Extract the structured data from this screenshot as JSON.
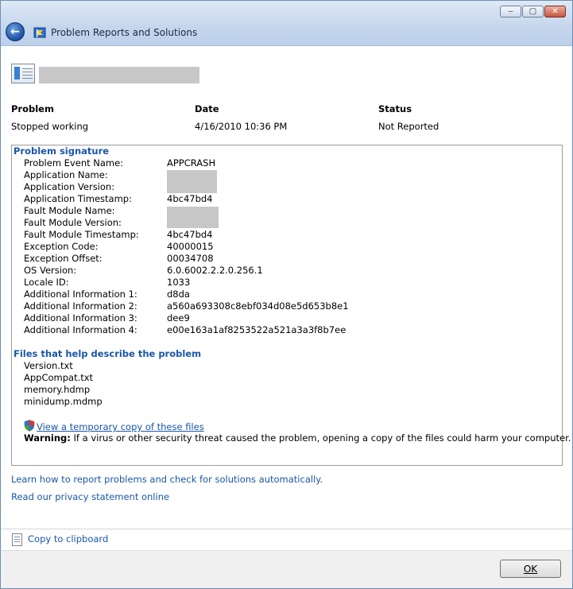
{
  "window": {
    "title": "Problem Reports and Solutions",
    "controls": {
      "minimize": "‒",
      "maximize": "▢",
      "close": "✕"
    }
  },
  "columns": {
    "problem_label": "Problem",
    "date_label": "Date",
    "status_label": "Status",
    "problem_value": "Stopped working",
    "date_value": "4/16/2010 10:36 PM",
    "status_value": "Not Reported"
  },
  "signature": {
    "heading": "Problem signature",
    "rows": [
      {
        "label": "Problem Event Name:",
        "value": "APPCRASH"
      },
      {
        "label": "Application Name:",
        "value": ""
      },
      {
        "label": "Application Version:",
        "value": ""
      },
      {
        "label": "Application Timestamp:",
        "value": "4bc47bd4"
      },
      {
        "label": "Fault Module Name:",
        "value": ""
      },
      {
        "label": "Fault Module Version:",
        "value": ""
      },
      {
        "label": "Fault Module Timestamp:",
        "value": "4bc47bd4"
      },
      {
        "label": "Exception Code:",
        "value": "40000015"
      },
      {
        "label": "Exception Offset:",
        "value": "00034708"
      },
      {
        "label": "OS Version:",
        "value": "6.0.6002.2.2.0.256.1"
      },
      {
        "label": "Locale ID:",
        "value": "1033"
      },
      {
        "label": "Additional Information 1:",
        "value": "d8da"
      },
      {
        "label": "Additional Information 2:",
        "value": "a560a693308c8ebf034d08e5d653b8e1"
      },
      {
        "label": "Additional Information 3:",
        "value": "dee9"
      },
      {
        "label": "Additional Information 4:",
        "value": "e00e163a1af8253522a521a3a3f8b7ee"
      }
    ]
  },
  "files": {
    "heading": "Files that help describe the problem",
    "items": [
      "Version.txt",
      "AppCompat.txt",
      "memory.hdmp",
      "minidump.mdmp"
    ],
    "view_link": "View a temporary copy of these files",
    "warning_label": "Warning:",
    "warning_text": " If a virus or other security threat caused the problem, opening a copy of the files could harm your computer."
  },
  "links": {
    "learn": "Learn how to report problems and check for solutions automatically.",
    "privacy": "Read our privacy statement online",
    "copy": "Copy to clipboard"
  },
  "buttons": {
    "ok": "OK"
  },
  "icons": {
    "back": "back-arrow-icon",
    "app": "action-center-flag-icon",
    "header": "window-icon",
    "shield": "uac-shield-icon",
    "clipboard": "copy-document-icon"
  },
  "colors": {
    "link": "#1a56a8",
    "titlebar": "#c5d6ec"
  }
}
